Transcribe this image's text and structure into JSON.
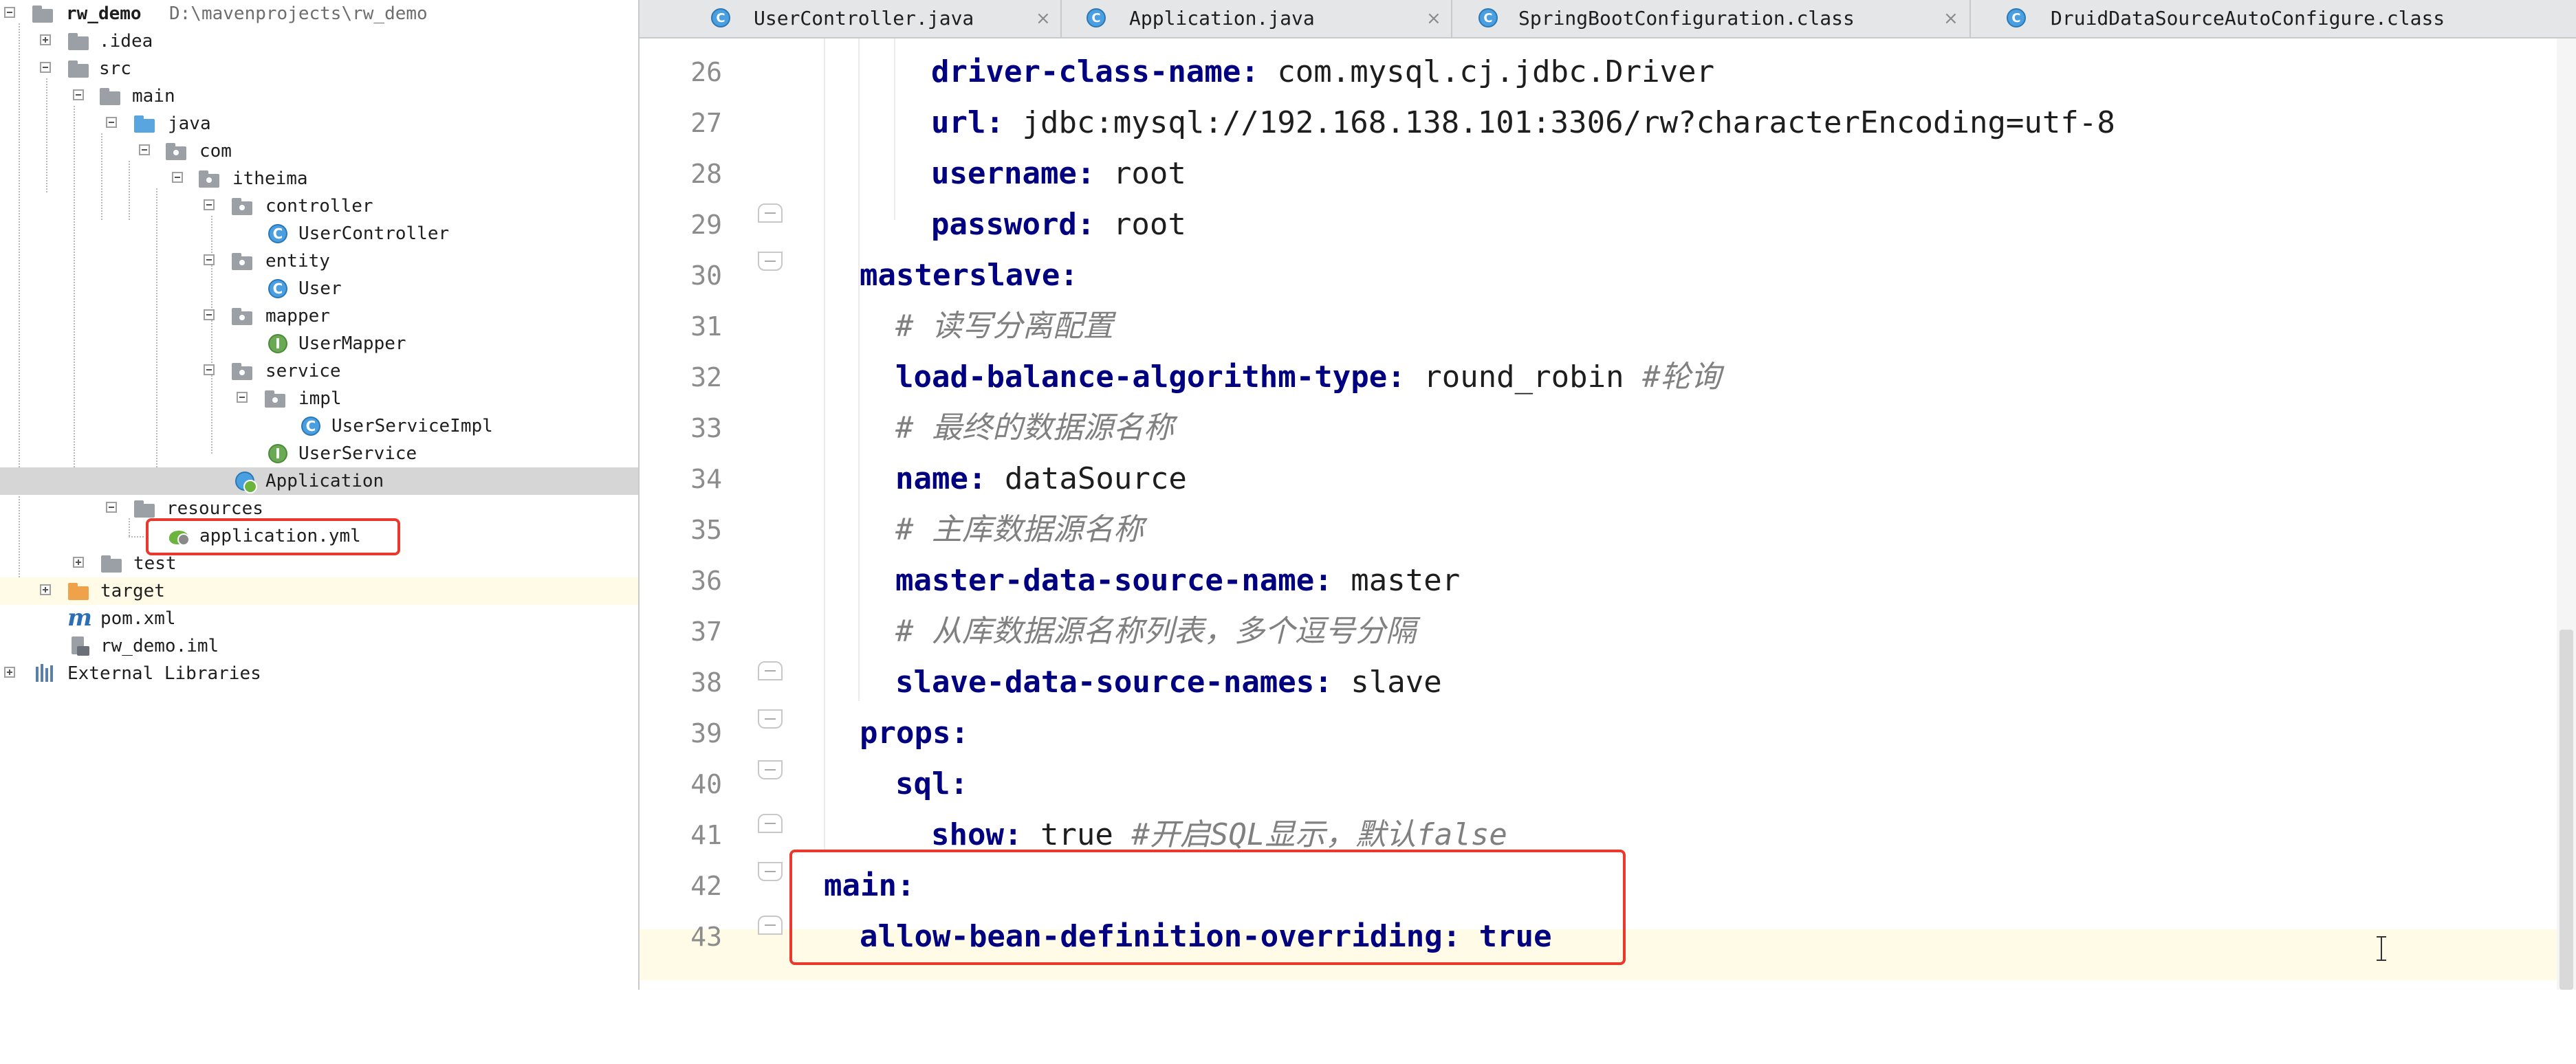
{
  "project": {
    "root": {
      "name": "rw_demo",
      "path": "D:\\mavenprojects\\rw_demo"
    },
    "tree": [
      {
        "label": ".idea"
      },
      {
        "label": "src"
      },
      {
        "label": "main"
      },
      {
        "label": "java"
      },
      {
        "label": "com"
      },
      {
        "label": "itheima"
      },
      {
        "label": "controller"
      },
      {
        "label": "UserController"
      },
      {
        "label": "entity"
      },
      {
        "label": "User"
      },
      {
        "label": "mapper"
      },
      {
        "label": "UserMapper"
      },
      {
        "label": "service"
      },
      {
        "label": "impl"
      },
      {
        "label": "UserServiceImpl"
      },
      {
        "label": "UserService"
      },
      {
        "label": "Application"
      },
      {
        "label": "resources"
      },
      {
        "label": "application.yml"
      },
      {
        "label": "test"
      },
      {
        "label": "target"
      },
      {
        "label": "pom.xml"
      },
      {
        "label": "rw_demo.iml"
      },
      {
        "label": "External Libraries"
      }
    ],
    "badges": {
      "class": "C",
      "interface": "I"
    }
  },
  "editor": {
    "tabs": [
      {
        "label": "UserController.java",
        "icon": "C",
        "close": "×"
      },
      {
        "label": "Application.java",
        "icon": "C",
        "close": "×"
      },
      {
        "label": "SpringBootConfiguration.class",
        "icon": "C",
        "close": "×"
      },
      {
        "label": "DruidDataSourceAutoConfigure.class",
        "icon": "C"
      }
    ],
    "check_mark": "✓",
    "lines": [
      {
        "num": "26",
        "key": "driver-class-name:",
        "val": " com.mysql.cj.jdbc.Driver",
        "cmt": ""
      },
      {
        "num": "27",
        "key": "url:",
        "val": " jdbc:mysql://192.168.138.101:3306/rw?characterEncoding=utf-8",
        "cmt": ""
      },
      {
        "num": "28",
        "key": "username:",
        "val": " root",
        "cmt": ""
      },
      {
        "num": "29",
        "key": "password:",
        "val": " root",
        "cmt": ""
      },
      {
        "num": "30",
        "key": "masterslave:",
        "val": "",
        "cmt": ""
      },
      {
        "num": "31",
        "key": "",
        "val": "",
        "cmt": "# 读写分离配置"
      },
      {
        "num": "32",
        "key": "load-balance-algorithm-type:",
        "val": " round_robin ",
        "cmt": "#轮询"
      },
      {
        "num": "33",
        "key": "",
        "val": "",
        "cmt": "# 最终的数据源名称"
      },
      {
        "num": "34",
        "key": "name:",
        "val": " dataSource",
        "cmt": ""
      },
      {
        "num": "35",
        "key": "",
        "val": "",
        "cmt": "# 主库数据源名称"
      },
      {
        "num": "36",
        "key": "master-data-source-name:",
        "val": " master",
        "cmt": ""
      },
      {
        "num": "37",
        "key": "",
        "val": "",
        "cmt": "# 从库数据源名称列表，多个逗号分隔"
      },
      {
        "num": "38",
        "key": "slave-data-source-names:",
        "val": " slave",
        "cmt": ""
      },
      {
        "num": "39",
        "key": "props:",
        "val": "",
        "cmt": ""
      },
      {
        "num": "40",
        "key": "sql:",
        "val": "",
        "cmt": ""
      },
      {
        "num": "41",
        "key": "show:",
        "val": " true ",
        "cmt": "#开启SQL显示，默认false"
      },
      {
        "num": "42",
        "key": "main:",
        "val": "",
        "cmt": ""
      },
      {
        "num": "43",
        "key": "allow-bean-definition-overriding: true",
        "val": "",
        "cmt": ""
      }
    ]
  },
  "colors": {
    "key": "#000080",
    "comment": "#808080",
    "annotation": "#e8392c",
    "caret_line": "#fffbe6",
    "selected_row": "#d6d6d6"
  }
}
